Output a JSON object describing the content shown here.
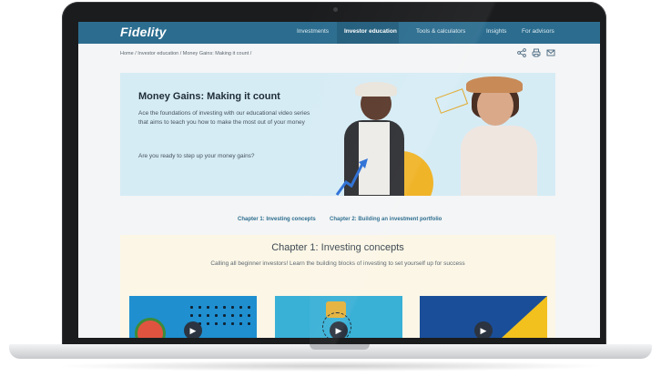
{
  "site": {
    "logo": "Fidelity",
    "nav": [
      "Investments",
      "Investor education",
      "Tools & calculators",
      "Insights",
      "For advisors"
    ],
    "active_nav": "Investor education"
  },
  "breadcrumb": "Home / Investor education / Money Gains: Making it count /",
  "utility_icons": [
    "share-icon",
    "print-icon",
    "email-icon"
  ],
  "hero": {
    "title": "Money Gains: Making it count",
    "description": "Ace the foundations of investing with our educational video series that aims to teach you how to make the most out of your money",
    "question": "Are you ready to step up your money gains?"
  },
  "chapter_links": [
    "Chapter 1: Investing concepts",
    "Chapter 2: Building an investment portfolio"
  ],
  "chapter": {
    "title": "Chapter 1: Investing concepts",
    "subtitle": "Calling all beginner investors! Learn the building blocks of investing to set yourself up for success"
  },
  "colors": {
    "header": "#2c6d8f",
    "hero_bg": "#d6ecf5",
    "chapter_bg": "#fbf6e6",
    "accent_yellow": "#f0b429"
  }
}
